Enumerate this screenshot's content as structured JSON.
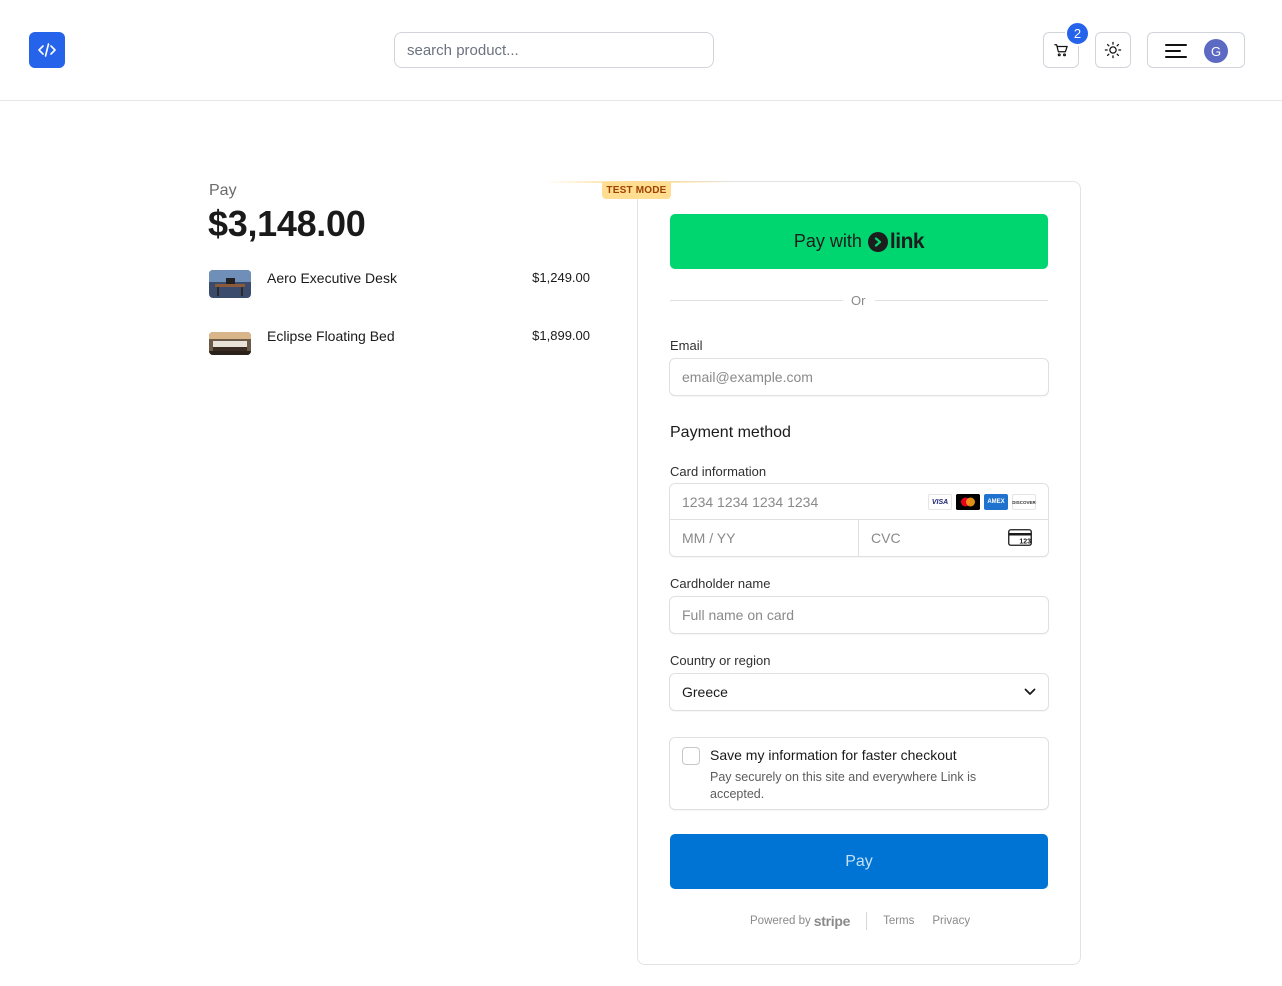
{
  "header": {
    "search_placeholder": "search product...",
    "cart_count": "2",
    "avatar_initial": "G"
  },
  "summary": {
    "pay_label": "Pay",
    "total": "$3,148.00",
    "items": [
      {
        "name": "Aero Executive Desk",
        "price": "$1,249.00"
      },
      {
        "name": "Eclipse Floating Bed",
        "price": "$1,899.00"
      }
    ]
  },
  "checkout": {
    "test_mode": "TEST MODE",
    "link_button_prefix": "Pay with",
    "link_button_brand": "link",
    "or": "Or",
    "email_label": "Email",
    "email_placeholder": "email@example.com",
    "payment_method_title": "Payment method",
    "card_info_label": "Card information",
    "card_number_placeholder": "1234 1234 1234 1234",
    "expiry_placeholder": "MM / YY",
    "cvc_placeholder": "CVC",
    "cvc_icon_text": "123",
    "card_brands": [
      "VISA",
      "mastercard",
      "AMEX",
      "DISCOVER"
    ],
    "cardholder_label": "Cardholder name",
    "cardholder_placeholder": "Full name on card",
    "country_label": "Country or region",
    "country_value": "Greece",
    "save_title": "Save my information for faster checkout",
    "save_desc": "Pay securely on this site and everywhere Link is accepted.",
    "pay_button": "Pay",
    "powered_by": "Powered by",
    "stripe": "stripe",
    "terms": "Terms",
    "privacy": "Privacy"
  },
  "colors": {
    "brand_blue": "#2563eb",
    "link_green": "#00d66f",
    "pay_blue": "#0074d4",
    "test_badge": "#ffde92"
  }
}
